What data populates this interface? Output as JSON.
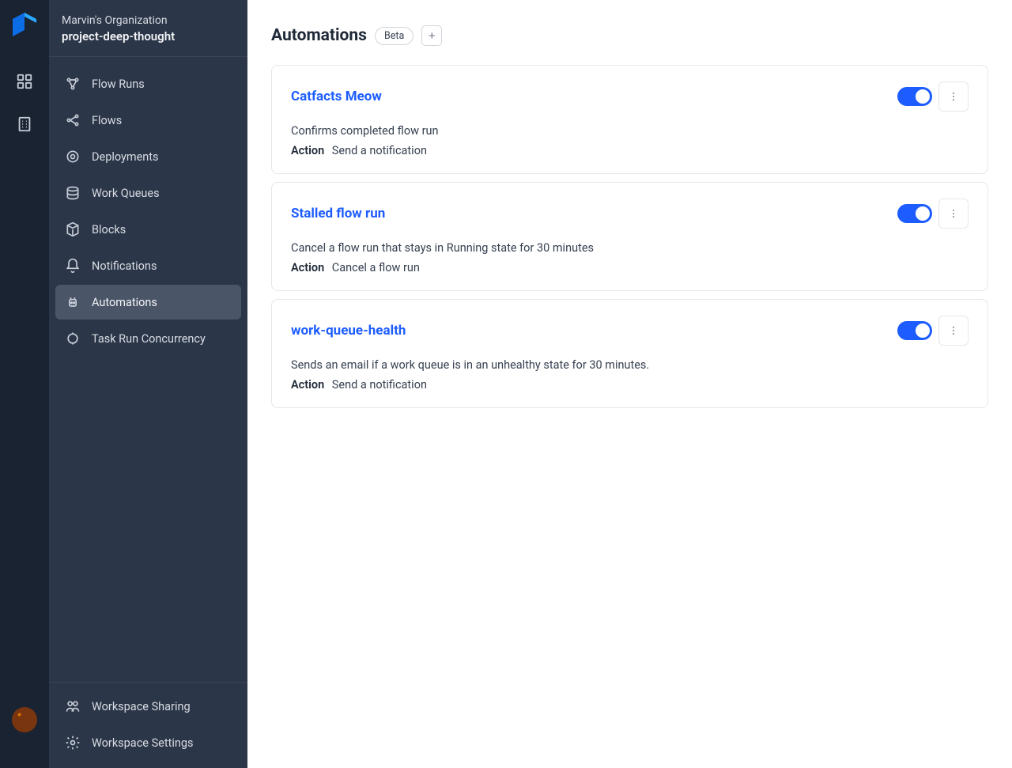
{
  "header": {
    "org": "Marvin's Organization",
    "project": "project-deep-thought"
  },
  "sidebar": {
    "items": [
      {
        "label": "Flow Runs",
        "icon": "flow-runs-icon",
        "active": false
      },
      {
        "label": "Flows",
        "icon": "flows-icon",
        "active": false
      },
      {
        "label": "Deployments",
        "icon": "deployments-icon",
        "active": false
      },
      {
        "label": "Work Queues",
        "icon": "work-queues-icon",
        "active": false
      },
      {
        "label": "Blocks",
        "icon": "blocks-icon",
        "active": false
      },
      {
        "label": "Notifications",
        "icon": "notifications-icon",
        "active": false
      },
      {
        "label": "Automations",
        "icon": "automations-icon",
        "active": true
      },
      {
        "label": "Task Run Concurrency",
        "icon": "concurrency-icon",
        "active": false
      }
    ],
    "footer": [
      {
        "label": "Workspace Sharing",
        "icon": "sharing-icon"
      },
      {
        "label": "Workspace Settings",
        "icon": "settings-icon"
      }
    ]
  },
  "page": {
    "title": "Automations",
    "badge": "Beta",
    "action_label": "Action"
  },
  "automations": [
    {
      "name": "Catfacts Meow",
      "description": "Confirms completed flow run",
      "action": "Send a notification",
      "enabled": true
    },
    {
      "name": "Stalled flow run",
      "description": "Cancel a flow run that stays in Running state for 30 minutes",
      "action": "Cancel a flow run",
      "enabled": true
    },
    {
      "name": "work-queue-health",
      "description": "Sends an email if a work queue is in an unhealthy state for 30 minutes.",
      "action": "Send a notification",
      "enabled": true
    }
  ]
}
